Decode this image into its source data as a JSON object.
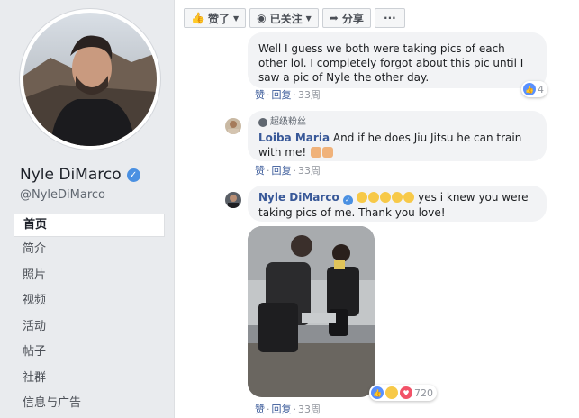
{
  "profile": {
    "name": "Nyle DiMarco",
    "handle": "@NyleDiMarco"
  },
  "nav": {
    "items": [
      {
        "label": "首页",
        "active": true
      },
      {
        "label": "简介"
      },
      {
        "label": "照片"
      },
      {
        "label": "视频"
      },
      {
        "label": "活动"
      },
      {
        "label": "帖子"
      },
      {
        "label": "社群"
      },
      {
        "label": "信息与广告"
      }
    ]
  },
  "toolbar": {
    "like_label": "赞了",
    "follow_label": "已关注",
    "share_label": "分享",
    "more_label": "···"
  },
  "comments": [
    {
      "text": "Well I guess we both were taking pics of each other lol. I completely forgot about this pic until I saw a pic of Nyle the other day.",
      "reactions": "4",
      "like": "赞",
      "reply": "回复",
      "time": "33周"
    },
    {
      "badge": "超级粉丝",
      "author": "Loiba Maria",
      "text": "And if he does Jiu Jitsu he can train with me!",
      "like": "赞",
      "reply": "回复",
      "time": "33周"
    },
    {
      "author": "Nyle DiMarco",
      "text": "yes i knew you were taking pics of me. Thank you love!",
      "reactions": "720",
      "like": "赞",
      "reply": "回复",
      "time": "33周"
    }
  ],
  "colors": {
    "link": "#385898",
    "like_blue": "#5890ff",
    "bubble": "#f2f3f5",
    "page_bg": "#e9ebee"
  }
}
